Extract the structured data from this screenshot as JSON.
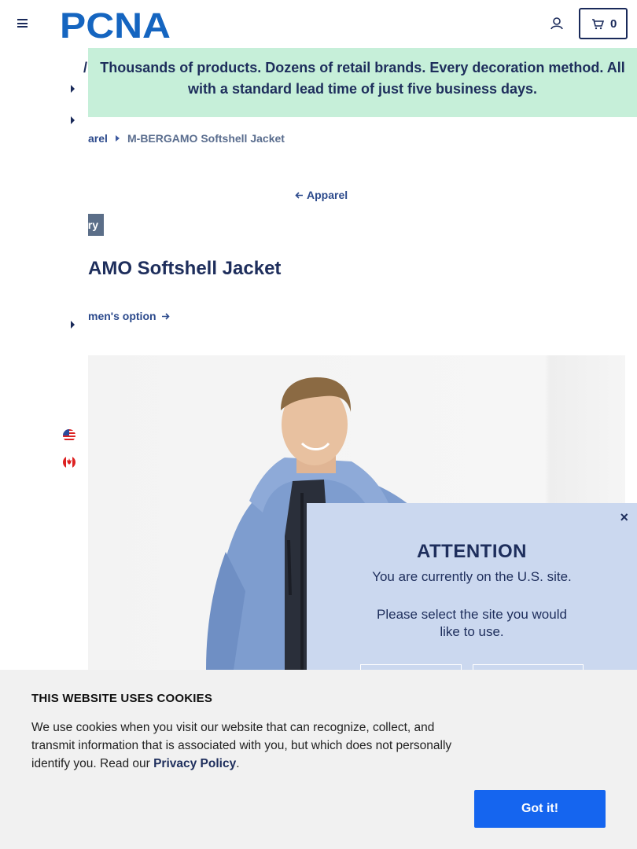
{
  "header": {
    "logo_text": "PCNA",
    "cart_count": "0"
  },
  "promo": {
    "leading_fragment": "/",
    "text": "Thousands of products. Dozens of retail brands. Every decoration method. All with a standard lead time of just five business days."
  },
  "breadcrumb": {
    "parent": "arel",
    "current": "M-BERGAMO Softshell Jacket"
  },
  "back_link": "Apparel",
  "badge": "ry",
  "product": {
    "title": "AMO Softshell Jacket",
    "option_link": "men's option"
  },
  "colors": {
    "brand_navy": "#1e2e5c",
    "promo_bg": "#c6efd9",
    "modal_bg": "#cbd8ef",
    "cookie_button": "#1565ef"
  },
  "modal": {
    "close": "×",
    "title": "ATTENTION",
    "line1": "You are currently on the U.S. site.",
    "line2": "Please select the site you would like to use."
  },
  "cookie": {
    "title": "THIS WEBSITE USES COOKIES",
    "body_pre": "We use cookies when you visit our website that can recognize, collect, and transmit information that is associated with you, but which does not personally identify you. Read our ",
    "policy_link": "Privacy Policy",
    "body_post": ".",
    "button": "Got it!"
  },
  "icons": [
    "hamburger-menu-icon",
    "account-icon",
    "cart-icon",
    "arrow-left-icon",
    "arrow-right-icon",
    "us-flag-icon",
    "canada-flag-icon",
    "close-icon"
  ]
}
